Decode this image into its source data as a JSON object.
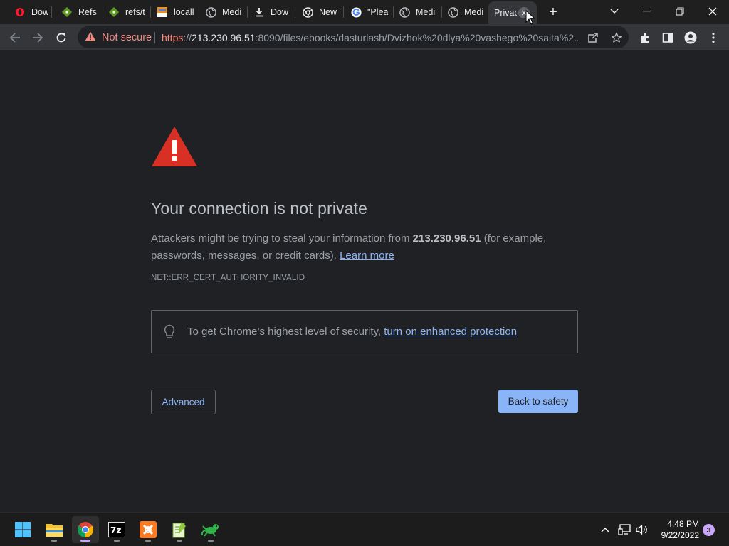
{
  "browser": {
    "tabs": [
      {
        "label": "Dow",
        "icon": "opera-icon"
      },
      {
        "label": "Refs",
        "icon": "git-icon"
      },
      {
        "label": "refs/t",
        "icon": "git-icon"
      },
      {
        "label": "locall",
        "icon": "phpmyadmin-icon"
      },
      {
        "label": "Medi",
        "icon": "globe-icon"
      },
      {
        "label": "Dow",
        "icon": "download-icon"
      },
      {
        "label": "New",
        "icon": "chrome-icon"
      },
      {
        "label": "\"Plea",
        "icon": "google-icon"
      },
      {
        "label": "Medi",
        "icon": "globe-icon"
      },
      {
        "label": "Medi",
        "icon": "globe-icon"
      },
      {
        "label": "Privac",
        "icon": "close-icon",
        "active": true
      }
    ],
    "omnibox": {
      "security_label": "Not secure",
      "url_scheme": "https",
      "url_sep": "://",
      "url_host": "213.230.96.51",
      "url_rest": ":8090/files/ebooks/dasturlash/Dvizhok%20dlya%20vashego%20saita%2..."
    }
  },
  "interstitial": {
    "heading": "Your connection is not private",
    "body_prefix": "Attackers might be trying to steal your information from ",
    "host": "213.230.96.51",
    "body_suffix": " (for example, passwords, messages, or credit cards). ",
    "learn_more": "Learn more",
    "error_code": "NET::ERR_CERT_AUTHORITY_INVALID",
    "security_prefix": "To get Chrome’s highest level of security, ",
    "security_link": "turn on enhanced protection",
    "advanced_button": "Advanced",
    "back_button": "Back to safety"
  },
  "taskbar": {
    "apps": [
      "start",
      "file-explorer",
      "chrome",
      "7zip",
      "xampp",
      "notepad-plus-plus",
      "gecko"
    ],
    "time": "4:48 PM",
    "date": "9/22/2022",
    "notification_count": "3"
  },
  "colors": {
    "page_bg": "#202124",
    "link": "#8ab4f8",
    "warning_red": "#d93025",
    "not_secure": "#f28b82"
  }
}
